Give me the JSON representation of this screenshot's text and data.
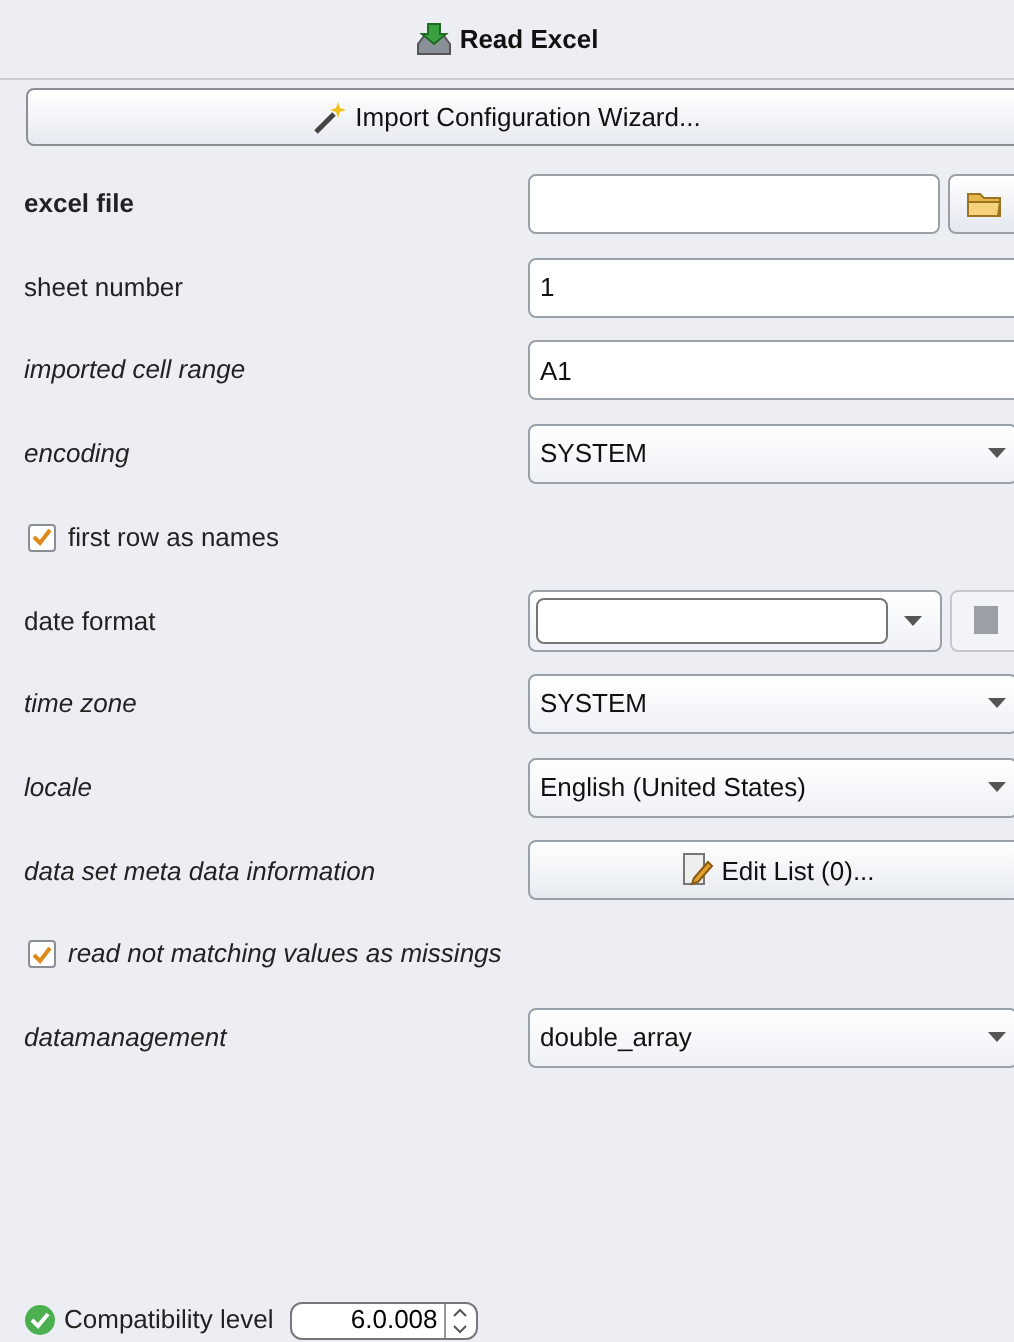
{
  "header": {
    "title": "Read Excel"
  },
  "wizard_button": {
    "label": "Import Configuration Wizard..."
  },
  "rows": [
    {
      "kind": "file",
      "label": "excel file",
      "bold": true,
      "italic": false,
      "value": ""
    },
    {
      "kind": "text",
      "label": "sheet number",
      "bold": false,
      "italic": false,
      "value": "1"
    },
    {
      "kind": "text",
      "label": "imported cell range",
      "bold": false,
      "italic": true,
      "value": "A1"
    },
    {
      "kind": "select",
      "label": "encoding",
      "bold": false,
      "italic": true,
      "value": "SYSTEM"
    },
    {
      "kind": "checkbox",
      "label": "first row as names",
      "bold": false,
      "italic": false,
      "checked": true
    },
    {
      "kind": "date",
      "label": "date format",
      "bold": false,
      "italic": false,
      "value": ""
    },
    {
      "kind": "select",
      "label": "time zone",
      "bold": false,
      "italic": true,
      "value": "SYSTEM"
    },
    {
      "kind": "select",
      "label": "locale",
      "bold": false,
      "italic": true,
      "value": "English (United States)"
    },
    {
      "kind": "button",
      "label": "data set meta data information",
      "bold": false,
      "italic": true,
      "value": "Edit List (0)..."
    },
    {
      "kind": "checkbox",
      "label": "read not matching values as missings",
      "bold": false,
      "italic": true,
      "checked": true
    },
    {
      "kind": "select",
      "label": "datamanagement",
      "bold": false,
      "italic": true,
      "value": "double_array"
    }
  ],
  "compatibility": {
    "label": "Compatibility level",
    "value": "6.0.008"
  }
}
